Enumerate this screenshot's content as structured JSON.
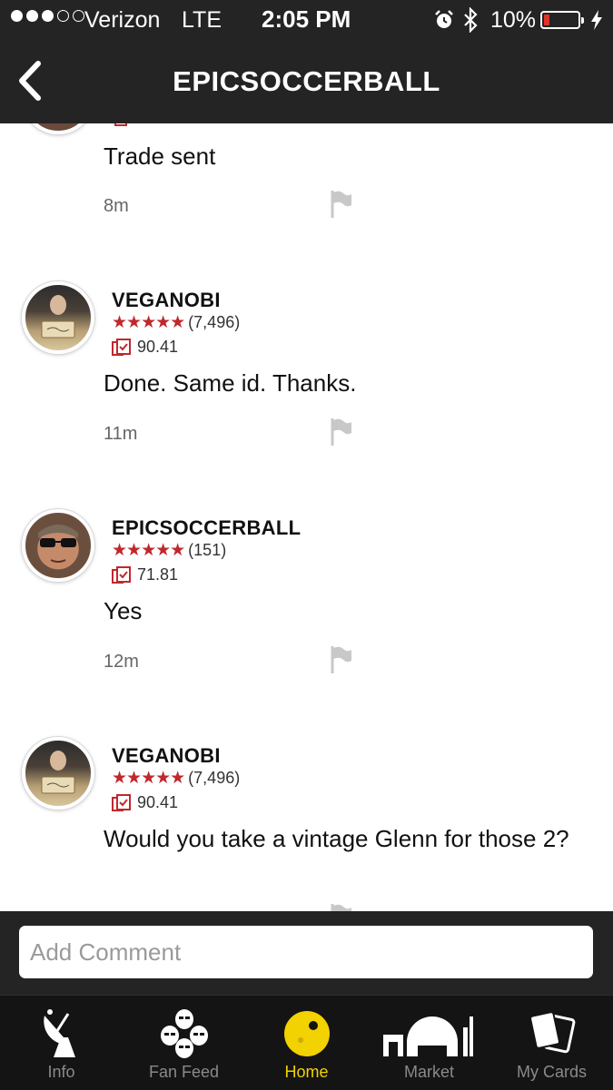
{
  "status_bar": {
    "carrier": "Verizon",
    "network": "LTE",
    "time": "2:05 PM",
    "battery": "10%",
    "signal_bars": 3,
    "signal_total": 5,
    "battery_level_fraction": 0.1,
    "battery_color": "#e0342a"
  },
  "nav": {
    "title": "EPICSOCCERBALL"
  },
  "comments": [
    {
      "partial": true,
      "text": "Trade sent",
      "time": "8m"
    },
    {
      "user": "VEGANOBI",
      "stars": "★★★★★",
      "rating_count": "(7,496)",
      "score": "90.41",
      "text": "Done. Same id. Thanks.",
      "time": "11m"
    },
    {
      "user": "EPICSOCCERBALL",
      "stars": "★★★★★",
      "rating_count": "(151)",
      "score": "71.81",
      "text": "Yes",
      "time": "12m"
    },
    {
      "user": "VEGANOBI",
      "stars": "★★★★★",
      "rating_count": "(7,496)",
      "score": "90.41",
      "text": "Would you take a vintage Glenn for those 2?"
    }
  ],
  "composer": {
    "placeholder": "Add Comment"
  },
  "tabs": [
    {
      "label": "Info",
      "icon": "satellite-dish-icon"
    },
    {
      "label": "Fan Feed",
      "icon": "stormtroopers-icon"
    },
    {
      "label": "Home",
      "icon": "home-planet-icon",
      "active": true
    },
    {
      "label": "Market",
      "icon": "market-dome-icon"
    },
    {
      "label": "My Cards",
      "icon": "cards-icon"
    }
  ],
  "colors": {
    "accent": "#f2d200",
    "star": "#c0282d",
    "bar": "#242424",
    "tabbar": "#141414"
  }
}
